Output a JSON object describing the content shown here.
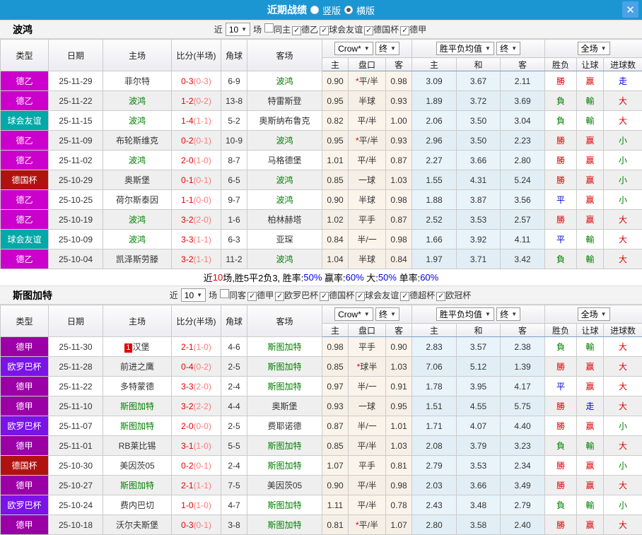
{
  "titlebar": {
    "title": "近期战绩",
    "radio_vertical": "竖版",
    "radio_horizontal": "横版",
    "close_label": "✕"
  },
  "colors": {
    "titlebar_bg": "#1C96D3",
    "close_bg": "#4CA2E6",
    "score_red": "#E60000",
    "focus_team_green": "#008000",
    "odds_bg": "#FBF4EB",
    "avg_bg": "#E8F3FA"
  },
  "league_colors": {
    "德乙": "#CC00CC",
    "球会友谊": "#00A8A8",
    "德国杯": "#B01212",
    "德甲": "#9A00A5",
    "欧罗巴杯": "#7B12E8"
  },
  "result_colors": {
    "勝": "#E00000",
    "負": "#008000",
    "平": "#0000E6",
    "赢": "#E00000",
    "輸": "#008000",
    "走": "#0000E6",
    "大": "#E00000",
    "小": "#008000"
  },
  "table_header": {
    "type": "类型",
    "date": "日期",
    "home": "主场",
    "score": "比分(半场)",
    "corner": "角球",
    "away": "客场",
    "dd_crow": "Crow*",
    "dd_final1": "终",
    "dd_avg": "胜平负均值",
    "dd_final2": "终",
    "dd_full": "全场",
    "sub": [
      "主",
      "盘口",
      "客",
      "主",
      "和",
      "客",
      "胜负",
      "让球",
      "进球数"
    ]
  },
  "sections": [
    {
      "team": "波鸿",
      "filter": {
        "near_label": "近",
        "count": "10",
        "games_label": "场",
        "same": {
          "label": "同主",
          "checked": false
        },
        "leagues": [
          {
            "label": "德乙",
            "checked": true
          },
          {
            "label": "球会友谊",
            "checked": true
          },
          {
            "label": "德国杯",
            "checked": true
          },
          {
            "label": "德甲",
            "checked": true
          }
        ]
      },
      "rows": [
        {
          "lg": "德乙",
          "date": "25-11-29",
          "home": "菲尔特",
          "hg": false,
          "score": "0-3",
          "half": "(0-3)",
          "corner": "6-9",
          "away": "波鸿",
          "ag": true,
          "oh": "0.90",
          "pan": "*平/半",
          "oa": "0.98",
          "avg": [
            "3.09",
            "3.67",
            "2.11"
          ],
          "res": [
            "勝",
            "赢",
            "走"
          ]
        },
        {
          "lg": "德乙",
          "date": "25-11-22",
          "home": "波鸿",
          "hg": true,
          "score": "1-2",
          "half": "(0-2)",
          "corner": "13-8",
          "away": "特雷斯登",
          "ag": false,
          "oh": "0.95",
          "pan": "半球",
          "oa": "0.93",
          "avg": [
            "1.89",
            "3.72",
            "3.69"
          ],
          "res": [
            "負",
            "輸",
            "大"
          ]
        },
        {
          "lg": "球会友谊",
          "date": "25-11-15",
          "home": "波鸿",
          "hg": true,
          "score": "1-4",
          "half": "(1-1)",
          "corner": "5-2",
          "away": "奥斯纳布鲁克",
          "ag": false,
          "oh": "0.82",
          "pan": "平/半",
          "oa": "1.00",
          "avg": [
            "2.06",
            "3.50",
            "3.04"
          ],
          "res": [
            "負",
            "輸",
            "大"
          ]
        },
        {
          "lg": "德乙",
          "date": "25-11-09",
          "home": "布轮斯维克",
          "hg": false,
          "score": "0-2",
          "half": "(0-1)",
          "corner": "10-9",
          "away": "波鸿",
          "ag": true,
          "oh": "0.95",
          "pan": "*平/半",
          "oa": "0.93",
          "avg": [
            "2.96",
            "3.50",
            "2.23"
          ],
          "res": [
            "勝",
            "赢",
            "小"
          ]
        },
        {
          "lg": "德乙",
          "date": "25-11-02",
          "home": "波鸿",
          "hg": true,
          "score": "2-0",
          "half": "(1-0)",
          "corner": "8-7",
          "away": "马格德堡",
          "ag": false,
          "oh": "1.01",
          "pan": "平/半",
          "oa": "0.87",
          "avg": [
            "2.27",
            "3.66",
            "2.80"
          ],
          "res": [
            "勝",
            "赢",
            "小"
          ]
        },
        {
          "lg": "德国杯",
          "date": "25-10-29",
          "home": "奥斯堡",
          "hg": false,
          "score": "0-1",
          "half": "(0-1)",
          "corner": "6-5",
          "away": "波鸿",
          "ag": true,
          "oh": "0.85",
          "pan": "一球",
          "oa": "1.03",
          "avg": [
            "1.55",
            "4.31",
            "5.24"
          ],
          "res": [
            "勝",
            "赢",
            "小"
          ]
        },
        {
          "lg": "德乙",
          "date": "25-10-25",
          "home": "荷尔斯泰因",
          "hg": false,
          "score": "1-1",
          "half": "(0-0)",
          "corner": "9-7",
          "away": "波鸿",
          "ag": true,
          "oh": "0.90",
          "pan": "半球",
          "oa": "0.98",
          "avg": [
            "1.88",
            "3.87",
            "3.56"
          ],
          "res": [
            "平",
            "赢",
            "小"
          ]
        },
        {
          "lg": "德乙",
          "date": "25-10-19",
          "home": "波鸿",
          "hg": true,
          "score": "3-2",
          "half": "(2-0)",
          "corner": "1-6",
          "away": "柏林赫塔",
          "ag": false,
          "oh": "1.02",
          "pan": "平手",
          "oa": "0.87",
          "avg": [
            "2.52",
            "3.53",
            "2.57"
          ],
          "res": [
            "勝",
            "赢",
            "大"
          ]
        },
        {
          "lg": "球会友谊",
          "date": "25-10-09",
          "home": "波鸿",
          "hg": true,
          "score": "3-3",
          "half": "(1-1)",
          "corner": "6-3",
          "away": "亚琛",
          "ag": false,
          "oh": "0.84",
          "pan": "半/一",
          "oa": "0.98",
          "avg": [
            "1.66",
            "3.92",
            "4.11"
          ],
          "res": [
            "平",
            "輸",
            "大"
          ]
        },
        {
          "lg": "德乙",
          "date": "25-10-04",
          "home": "凯泽斯劳滕",
          "hg": false,
          "score": "3-2",
          "half": "(1-1)",
          "corner": "11-2",
          "away": "波鸿",
          "ag": true,
          "oh": "1.04",
          "pan": "半球",
          "oa": "0.84",
          "avg": [
            "1.97",
            "3.71",
            "3.42"
          ],
          "res": [
            "負",
            "輸",
            "大"
          ]
        }
      ],
      "summary": [
        {
          "t": "近",
          "c": "k"
        },
        {
          "t": "10",
          "c": "r"
        },
        {
          "t": "场,胜5平2负3, 胜率:",
          "c": "k"
        },
        {
          "t": "50%",
          "c": "b"
        },
        {
          "t": " 赢率:",
          "c": "k"
        },
        {
          "t": "60%",
          "c": "b"
        },
        {
          "t": " 大:",
          "c": "k"
        },
        {
          "t": "50%",
          "c": "b"
        },
        {
          "t": " 单率:",
          "c": "k"
        },
        {
          "t": "60%",
          "c": "b"
        }
      ]
    },
    {
      "team": "斯图加特",
      "filter": {
        "near_label": "近",
        "count": "10",
        "games_label": "场",
        "same": {
          "label": "同客",
          "checked": false
        },
        "leagues": [
          {
            "label": "德甲",
            "checked": true
          },
          {
            "label": "欧罗巴杯",
            "checked": true
          },
          {
            "label": "德国杯",
            "checked": true
          },
          {
            "label": "球会友谊",
            "checked": true
          },
          {
            "label": "德超杯",
            "checked": true
          },
          {
            "label": "欧冠杯",
            "checked": true
          }
        ]
      },
      "rows": [
        {
          "lg": "德甲",
          "date": "25-11-30",
          "home": "汉堡",
          "home_badge": "1",
          "hg": false,
          "score": "2-1",
          "half": "(1-0)",
          "corner": "4-6",
          "away": "斯图加特",
          "ag": true,
          "oh": "0.98",
          "pan": "平手",
          "oa": "0.90",
          "avg": [
            "2.83",
            "3.57",
            "2.38"
          ],
          "res": [
            "負",
            "輸",
            "大"
          ]
        },
        {
          "lg": "欧罗巴杯",
          "date": "25-11-28",
          "home": "前进之鹰",
          "hg": false,
          "score": "0-4",
          "half": "(0-2)",
          "corner": "2-5",
          "away": "斯图加特",
          "ag": true,
          "oh": "0.85",
          "pan": "*球半",
          "oa": "1.03",
          "avg": [
            "7.06",
            "5.12",
            "1.39"
          ],
          "res": [
            "勝",
            "赢",
            "大"
          ]
        },
        {
          "lg": "德甲",
          "date": "25-11-22",
          "home": "多特蒙德",
          "hg": false,
          "score": "3-3",
          "half": "(2-0)",
          "corner": "2-4",
          "away": "斯图加特",
          "ag": true,
          "oh": "0.97",
          "pan": "半/一",
          "oa": "0.91",
          "avg": [
            "1.78",
            "3.95",
            "4.17"
          ],
          "res": [
            "平",
            "赢",
            "大"
          ]
        },
        {
          "lg": "德甲",
          "date": "25-11-10",
          "home": "斯图加特",
          "hg": true,
          "score": "3-2",
          "half": "(2-2)",
          "corner": "4-4",
          "away": "奥斯堡",
          "ag": false,
          "oh": "0.93",
          "pan": "一球",
          "oa": "0.95",
          "avg": [
            "1.51",
            "4.55",
            "5.75"
          ],
          "res": [
            "勝",
            "走",
            "大"
          ]
        },
        {
          "lg": "欧罗巴杯",
          "date": "25-11-07",
          "home": "斯图加特",
          "hg": true,
          "score": "2-0",
          "half": "(0-0)",
          "corner": "2-5",
          "away": "费耶诺德",
          "ag": false,
          "oh": "0.87",
          "pan": "半/一",
          "oa": "1.01",
          "avg": [
            "1.71",
            "4.07",
            "4.40"
          ],
          "res": [
            "勝",
            "赢",
            "小"
          ]
        },
        {
          "lg": "德甲",
          "date": "25-11-01",
          "home": "RB莱比锡",
          "hg": false,
          "score": "3-1",
          "half": "(1-0)",
          "corner": "5-5",
          "away": "斯图加特",
          "ag": true,
          "oh": "0.85",
          "pan": "平/半",
          "oa": "1.03",
          "avg": [
            "2.08",
            "3.79",
            "3.23"
          ],
          "res": [
            "負",
            "輸",
            "大"
          ]
        },
        {
          "lg": "德国杯",
          "date": "25-10-30",
          "home": "美因茨05",
          "hg": false,
          "score": "0-2",
          "half": "(0-1)",
          "corner": "2-4",
          "away": "斯图加特",
          "ag": true,
          "oh": "1.07",
          "pan": "平手",
          "oa": "0.81",
          "avg": [
            "2.79",
            "3.53",
            "2.34"
          ],
          "res": [
            "勝",
            "赢",
            "小"
          ]
        },
        {
          "lg": "德甲",
          "date": "25-10-27",
          "home": "斯图加特",
          "hg": true,
          "score": "2-1",
          "half": "(1-1)",
          "corner": "7-5",
          "away": "美因茨05",
          "ag": false,
          "oh": "0.90",
          "pan": "平/半",
          "oa": "0.98",
          "avg": [
            "2.03",
            "3.66",
            "3.49"
          ],
          "res": [
            "勝",
            "赢",
            "大"
          ]
        },
        {
          "lg": "欧罗巴杯",
          "date": "25-10-24",
          "home": "费内巴切",
          "hg": false,
          "score": "1-0",
          "half": "(1-0)",
          "corner": "4-7",
          "away": "斯图加特",
          "ag": true,
          "oh": "1.11",
          "pan": "平/半",
          "oa": "0.78",
          "avg": [
            "2.43",
            "3.48",
            "2.79"
          ],
          "res": [
            "負",
            "輸",
            "小"
          ]
        },
        {
          "lg": "德甲",
          "date": "25-10-18",
          "home": "沃尔夫斯堡",
          "hg": false,
          "score": "0-3",
          "half": "(0-1)",
          "corner": "3-8",
          "away": "斯图加特",
          "ag": true,
          "oh": "0.81",
          "pan": "*平/半",
          "oa": "1.07",
          "avg": [
            "2.80",
            "3.58",
            "2.40"
          ],
          "res": [
            "勝",
            "赢",
            "大"
          ]
        }
      ],
      "summary": null
    }
  ]
}
